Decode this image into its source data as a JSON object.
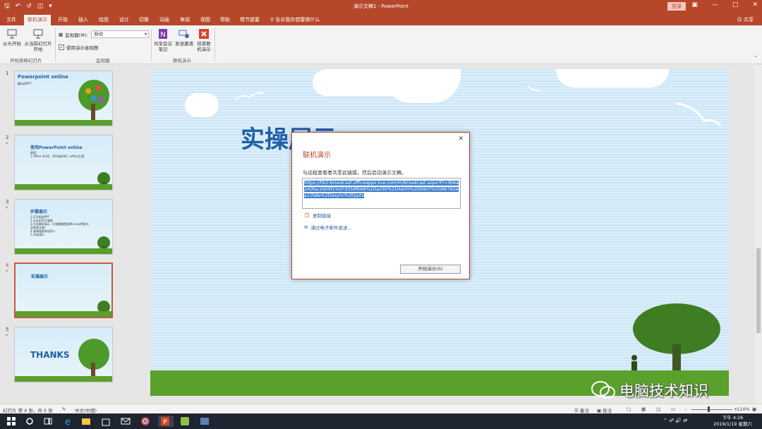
{
  "window": {
    "title": "演示文稿1 - PowerPoint",
    "login_label": "登录",
    "share_label": "共享"
  },
  "tabs": [
    {
      "label": "文件"
    },
    {
      "label": "联机演示"
    },
    {
      "label": "开始"
    },
    {
      "label": "插入"
    },
    {
      "label": "绘图"
    },
    {
      "label": "设计"
    },
    {
      "label": "切换"
    },
    {
      "label": "动画"
    },
    {
      "label": "审阅"
    },
    {
      "label": "视图"
    },
    {
      "label": "帮助"
    },
    {
      "label": "情节提要"
    }
  ],
  "tell_me": "告诉我你想要做什么",
  "ribbon": {
    "from_start": "从头开始",
    "from_current_line1": "从当前幻灯片",
    "from_current_line2": "开始",
    "group_start_show": "开始放映幻灯片",
    "monitor_label": "监视器(M):",
    "monitor_value": "自动",
    "use_presenter_view": "使用演示者视图",
    "group_monitor": "监视器",
    "share_notes_line1": "共享会议",
    "share_notes_line2": "笔记",
    "send_invite": "发送邀请",
    "end_online_line1": "结束联",
    "end_online_line2": "机演示",
    "group_online": "联机演示"
  },
  "slides": [
    {
      "num": "1",
      "title": "Powerpoint online",
      "sub": "趣玩的PPT",
      "star": ""
    },
    {
      "num": "2",
      "title": "使用PowerPoint online",
      "sub": "原因：\n1.Office 2016、2019或365（office正版）",
      "star": "*"
    },
    {
      "num": "3",
      "title": "步骤展示",
      "sub": "1.打开相应PPT\n2.点击幻灯片放映\n3.点击联机演示（可能需要登陆Microsoft账号，没有就注册）\n4.复制链接发给别人\n5.开始演示",
      "star": "*"
    },
    {
      "num": "4",
      "title": "实操展示",
      "sub": "",
      "star": "*"
    },
    {
      "num": "5",
      "title": "THANKS",
      "sub": "",
      "star": "*"
    }
  ],
  "main_slide": {
    "title": "实操展示"
  },
  "dialog": {
    "title": "联机演示",
    "description": "与远程查看者共享此链接，然后启动演示文稿。",
    "link": "https://hk2-broadcast.officeapps.live.com/m/Broadcast.aspx?Fi=3b6a240fac2600f1%5Fd358fb68%2Da290%2D4e00%2Db907%2D6b782ea11b8e%2Dasync%2Epptx",
    "copy_link": "复制链接",
    "send_email": "通过电子邮件发送...",
    "start_button": "开始演示(S)"
  },
  "statusbar": {
    "slide_info": "幻灯片 第 4 张，共 5 张",
    "language": "中文(中国)",
    "notes": "备注",
    "comments": "批注",
    "zoom": "114%"
  },
  "watermark": "电脑技术知识",
  "taskbar": {
    "time": "下午 4:26",
    "date": "2019/1/19 星期六"
  },
  "colors": {
    "accent": "#b7472a",
    "slide_title": "#1f5fa8",
    "grass": "#5aa02c"
  }
}
